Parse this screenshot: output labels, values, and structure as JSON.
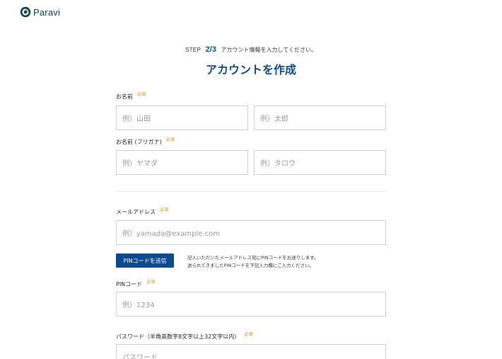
{
  "brand": {
    "name": "Paravi",
    "color": "#003a70",
    "accent": "#f5c400"
  },
  "step": {
    "label": "STEP",
    "number": "2/3",
    "text": "アカウント情報を入力してください。"
  },
  "title": "アカウントを作成",
  "required_label": "必須",
  "fields": {
    "name": {
      "label": "お名前",
      "last_placeholder": "例）山田",
      "first_placeholder": "例）太郎"
    },
    "kana": {
      "label": "お名前 (フリガナ)",
      "last_placeholder": "例）ヤマダ",
      "first_placeholder": "例）タロウ"
    },
    "email": {
      "label": "メールアドレス",
      "placeholder": "例）yamada@example.com"
    },
    "pin_button": "PINコードを送信",
    "pin_note_1": "記入いただいたメールアドレス宛にPINコードをお送りします。",
    "pin_note_2": "送られてきましたPINコードを下記入力欄にご入力ください。",
    "pin": {
      "label": "PINコード",
      "placeholder": "例）1234"
    },
    "password": {
      "label": "パスワード（半角英数字8文字以上32文字以内）",
      "placeholder": "パスワード"
    }
  },
  "colors": {
    "primary": "#0b4a90",
    "required": "#c79a00",
    "border": "#cfcfcf"
  }
}
